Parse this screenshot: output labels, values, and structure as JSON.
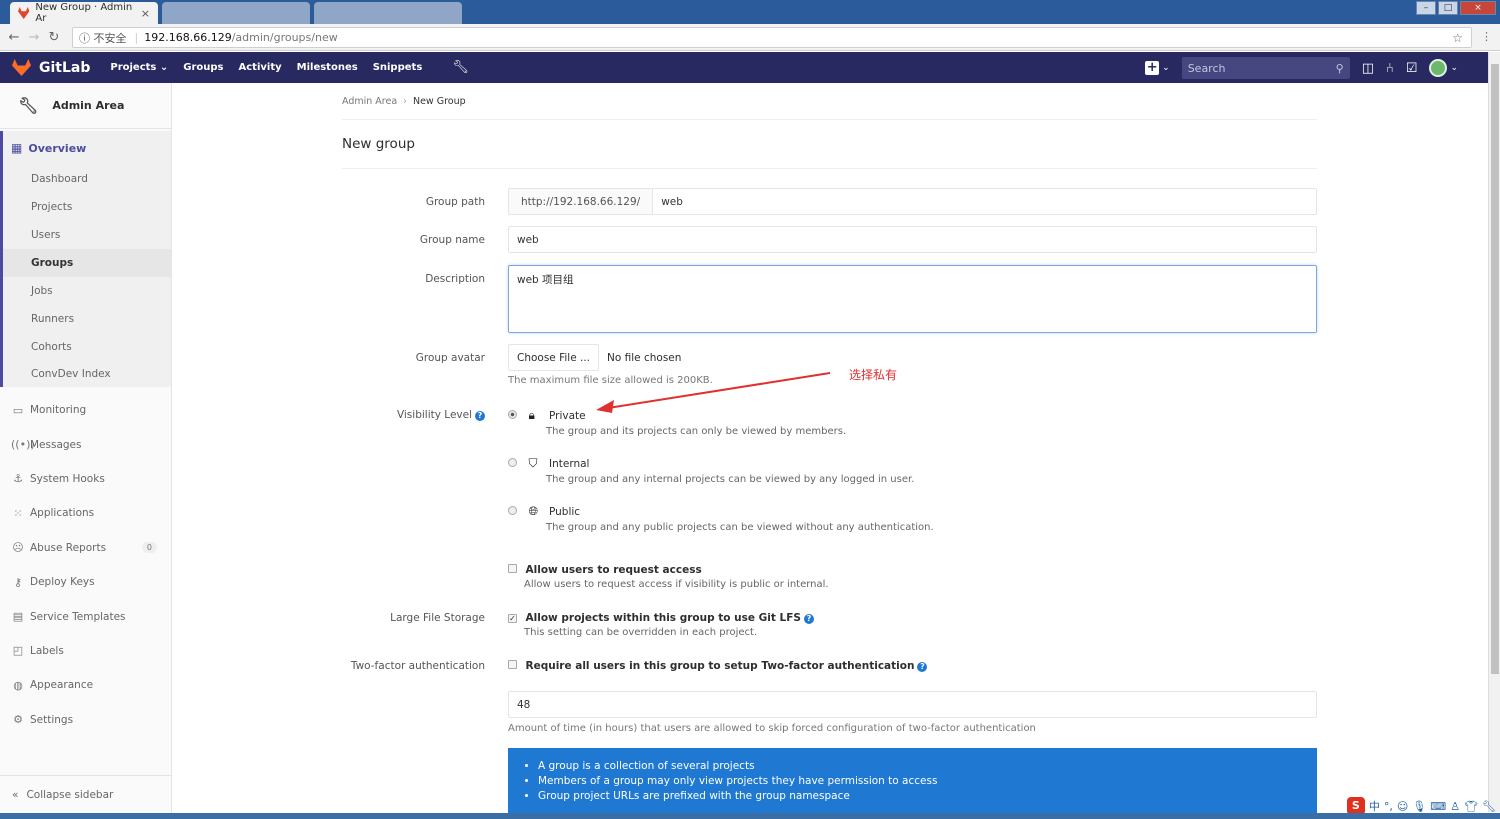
{
  "browser": {
    "active_tab_title": "New Group · Admin Ar",
    "inactive_tabs": [
      "",
      ""
    ],
    "security_label": "不安全",
    "url_host": "192.168.66.129",
    "url_path": "/admin/groups/new"
  },
  "header": {
    "brand": "GitLab",
    "nav": [
      "Projects",
      "Groups",
      "Activity",
      "Milestones",
      "Snippets"
    ],
    "search_placeholder": "Search"
  },
  "sidebar": {
    "title": "Admin Area",
    "overview_label": "Overview",
    "overview_items": [
      "Dashboard",
      "Projects",
      "Users",
      "Groups",
      "Jobs",
      "Runners",
      "Cohorts",
      "ConvDev Index"
    ],
    "items": [
      {
        "label": "Monitoring",
        "icon": "monitor-icon"
      },
      {
        "label": "Messages",
        "icon": "broadcast-icon"
      },
      {
        "label": "System Hooks",
        "icon": "hook-icon"
      },
      {
        "label": "Applications",
        "icon": "grid-icon"
      },
      {
        "label": "Abuse Reports",
        "icon": "warning-icon",
        "badge": "0"
      },
      {
        "label": "Deploy Keys",
        "icon": "key-icon"
      },
      {
        "label": "Service Templates",
        "icon": "template-icon"
      },
      {
        "label": "Labels",
        "icon": "label-icon"
      },
      {
        "label": "Appearance",
        "icon": "palette-icon"
      },
      {
        "label": "Settings",
        "icon": "gear-icon"
      }
    ],
    "collapse_label": "Collapse sidebar"
  },
  "breadcrumb": {
    "parent": "Admin Area",
    "current": "New Group"
  },
  "page": {
    "title": "New group"
  },
  "form": {
    "group_path_label": "Group path",
    "group_path_prefix": "http://192.168.66.129/",
    "group_path_value": "web",
    "group_name_label": "Group name",
    "group_name_value": "web",
    "description_label": "Description",
    "description_value": "web 项目组",
    "avatar_label": "Group avatar",
    "choose_file": "Choose File ...",
    "no_file": "No file chosen",
    "avatar_help": "The maximum file size allowed is 200KB.",
    "visibility_label": "Visibility Level",
    "visibility": [
      {
        "name": "Private",
        "desc": "The group and its projects can only be viewed by members.",
        "selected": true
      },
      {
        "name": "Internal",
        "desc": "The group and any internal projects can be viewed by any logged in user.",
        "selected": false
      },
      {
        "name": "Public",
        "desc": "The group and any public projects can be viewed without any authentication.",
        "selected": false
      }
    ],
    "request_access_title": "Allow users to request access",
    "request_access_desc": "Allow users to request access if visibility is public or internal.",
    "lfs_label": "Large File Storage",
    "lfs_title": "Allow projects within this group to use Git LFS",
    "lfs_desc": "This setting can be overridden in each project.",
    "tfa_label": "Two-factor authentication",
    "tfa_title": "Require all users in this group to setup Two-factor authentication",
    "tfa_hours": "48",
    "tfa_help": "Amount of time (in hours) that users are allowed to skip forced configuration of two-factor authentication"
  },
  "info": [
    "A group is a collection of several projects",
    "Members of a group may only view projects they have permission to access",
    "Group project URLs are prefixed with the group namespace"
  ],
  "annotation": "选择私有",
  "colors": {
    "header_bg": "#292961",
    "accent": "#4b4ba3",
    "info_bg": "#1f78d1",
    "annotation": "#e03030"
  }
}
